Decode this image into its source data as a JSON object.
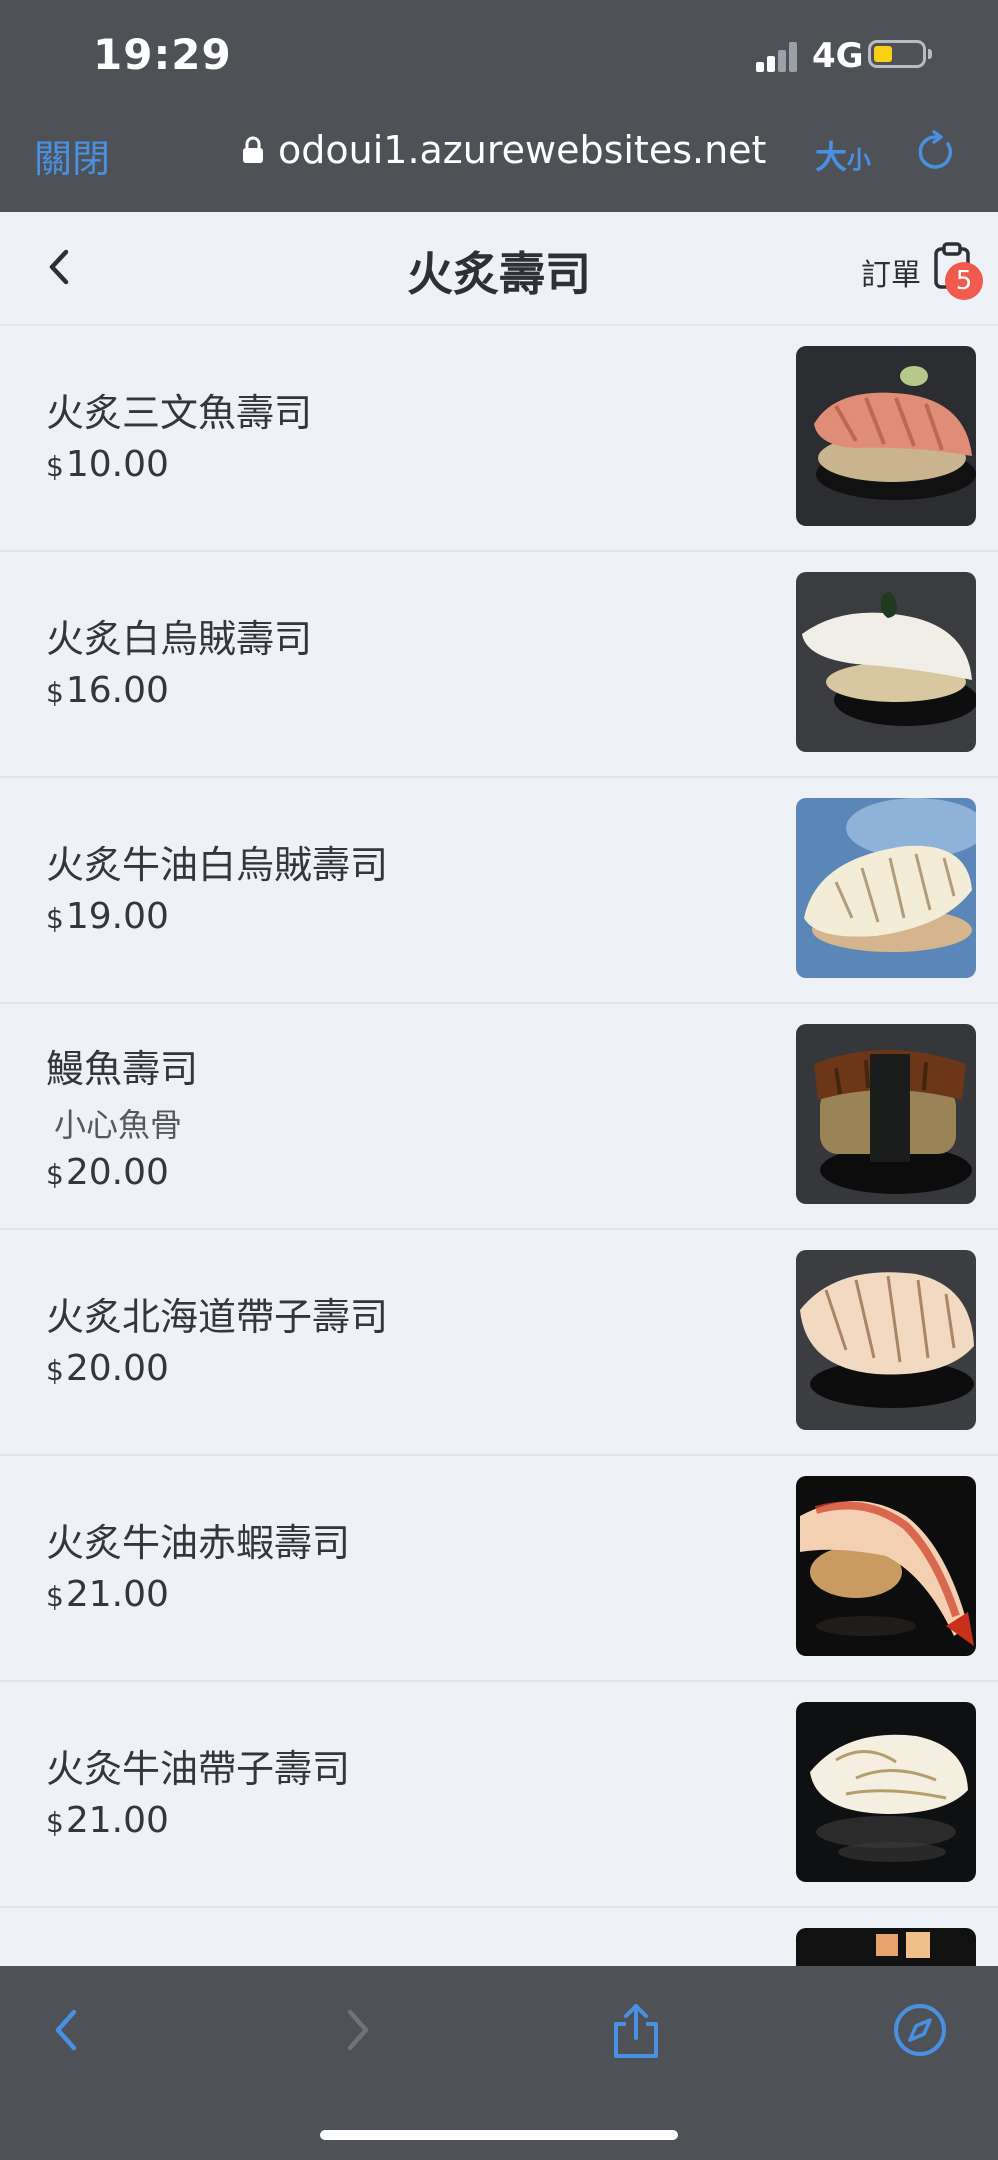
{
  "status_bar": {
    "time": "19:29",
    "network": "4G",
    "battery_level": 0.4
  },
  "browser": {
    "close_label": "關閉",
    "url": "odoui1.azurewebsites.net",
    "text_size_big": "大",
    "text_size_small": "小"
  },
  "header": {
    "title": "火炙壽司",
    "orders_label": "訂單",
    "orders_badge": "5"
  },
  "menu": {
    "items": [
      {
        "name": "火炙三文魚壽司",
        "note": "",
        "currency": "$",
        "price": "10.00",
        "image": "salmon-sushi-image"
      },
      {
        "name": "火炙白烏賊壽司",
        "note": "",
        "currency": "$",
        "price": "16.00",
        "image": "squid-sushi-image"
      },
      {
        "name": "火炙牛油白烏賊壽司",
        "note": "",
        "currency": "$",
        "price": "19.00",
        "image": "butter-squid-sushi-image"
      },
      {
        "name": "鰻魚壽司",
        "note": "小心魚骨",
        "currency": "$",
        "price": "20.00",
        "image": "eel-sushi-image"
      },
      {
        "name": "火炙北海道帶子壽司",
        "note": "",
        "currency": "$",
        "price": "20.00",
        "image": "scallop-sushi-image"
      },
      {
        "name": "火炙牛油赤蝦壽司",
        "note": "",
        "currency": "$",
        "price": "21.00",
        "image": "shrimp-sushi-image"
      },
      {
        "name": "火灸牛油帶子壽司",
        "note": "",
        "currency": "$",
        "price": "21.00",
        "image": "butter-scallop-sushi-image"
      }
    ]
  },
  "colors": {
    "accent": "#4a90e2",
    "chrome": "#4e5257",
    "background": "#eef2f6",
    "badge": "#f15a4f"
  }
}
